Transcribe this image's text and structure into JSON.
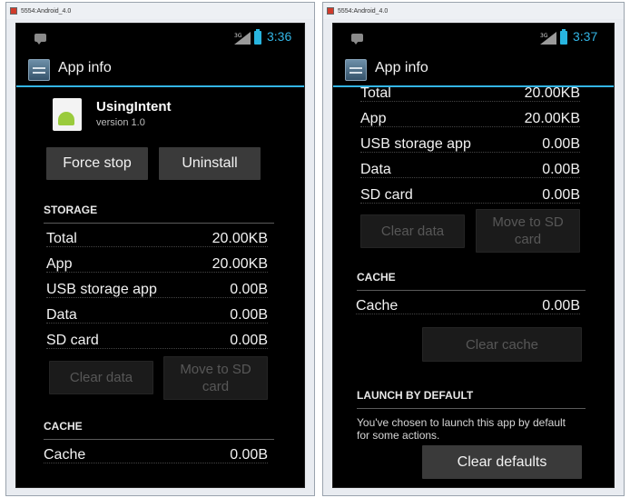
{
  "left_window": {
    "title": "5554:Android_4.0",
    "status": {
      "network": "3G",
      "time": "3:36"
    },
    "action_bar_title": "App info",
    "app": {
      "name": "UsingIntent",
      "version": "version 1.0"
    },
    "buttons": {
      "force_stop": "Force stop",
      "uninstall": "Uninstall"
    },
    "storage_header": "STORAGE",
    "storage_rows": [
      {
        "label": "Total",
        "value": "20.00KB"
      },
      {
        "label": "App",
        "value": "20.00KB"
      },
      {
        "label": "USB storage app",
        "value": "0.00B"
      },
      {
        "label": "Data",
        "value": "0.00B"
      },
      {
        "label": "SD card",
        "value": "0.00B"
      }
    ],
    "clear_data": "Clear data",
    "move_to_sd": "Move to SD card",
    "cache_header": "CACHE",
    "cache_row": {
      "label": "Cache",
      "value": "0.00B"
    }
  },
  "right_window": {
    "title": "5554:Android_4.0",
    "status": {
      "network": "3G",
      "time": "3:37"
    },
    "action_bar_title": "App info",
    "storage_rows": [
      {
        "label": "Total",
        "value": "20.00KB"
      },
      {
        "label": "App",
        "value": "20.00KB"
      },
      {
        "label": "USB storage app",
        "value": "0.00B"
      },
      {
        "label": "Data",
        "value": "0.00B"
      },
      {
        "label": "SD card",
        "value": "0.00B"
      }
    ],
    "clear_data": "Clear data",
    "move_to_sd": "Move to SD card",
    "cache_header": "CACHE",
    "cache_row": {
      "label": "Cache",
      "value": "0.00B"
    },
    "clear_cache": "Clear cache",
    "launch_header": "LAUNCH BY DEFAULT",
    "launch_text": "You've chosen to launch this app by default for some actions.",
    "clear_defaults": "Clear defaults"
  },
  "colors": {
    "accent": "#33b5e5",
    "screen_bg": "#000000",
    "button_bg": "#3a3a3a",
    "disabled_text": "#575757"
  }
}
